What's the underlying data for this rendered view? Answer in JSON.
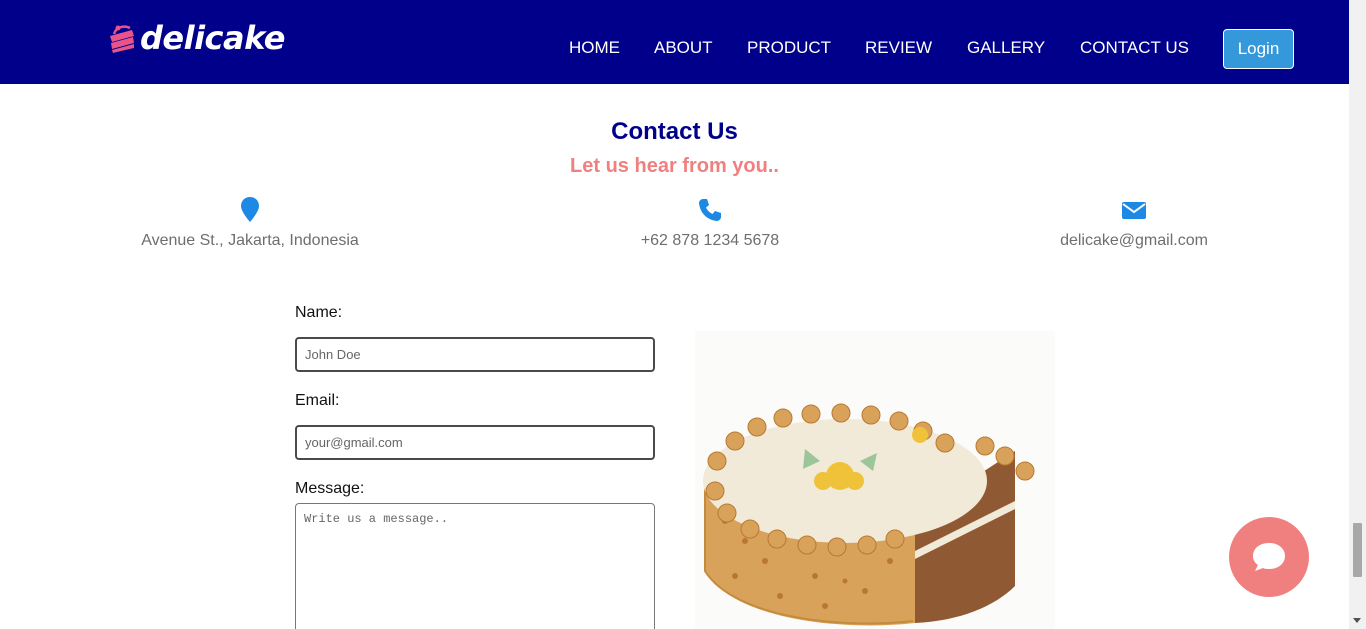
{
  "brand": {
    "name": "delicake"
  },
  "nav": {
    "items": [
      {
        "label": "HOME"
      },
      {
        "label": "ABOUT"
      },
      {
        "label": "PRODUCT"
      },
      {
        "label": "REVIEW"
      },
      {
        "label": "GALLERY"
      },
      {
        "label": "CONTACT US"
      }
    ],
    "login_label": "Login"
  },
  "contact": {
    "title": "Contact Us",
    "subtitle": "Let us hear from you..",
    "address": {
      "icon": "map-pin-icon",
      "text": "Avenue St., Jakarta, Indonesia"
    },
    "phone": {
      "icon": "phone-icon",
      "text": "+62 878 1234 5678"
    },
    "email": {
      "icon": "envelope-icon",
      "text": "delicake@gmail.com"
    }
  },
  "form": {
    "name_label": "Name:",
    "name_placeholder": "John Doe",
    "email_label": "Email:",
    "email_placeholder": "your@gmail.com",
    "message_label": "Message:",
    "message_placeholder": "Write us a message.."
  },
  "chat": {
    "icon": "chat-bubble-icon"
  },
  "colors": {
    "navbar": "#00008b",
    "accent": "#f08080",
    "login_button": "#3498db",
    "icon": "#1e88e5"
  }
}
